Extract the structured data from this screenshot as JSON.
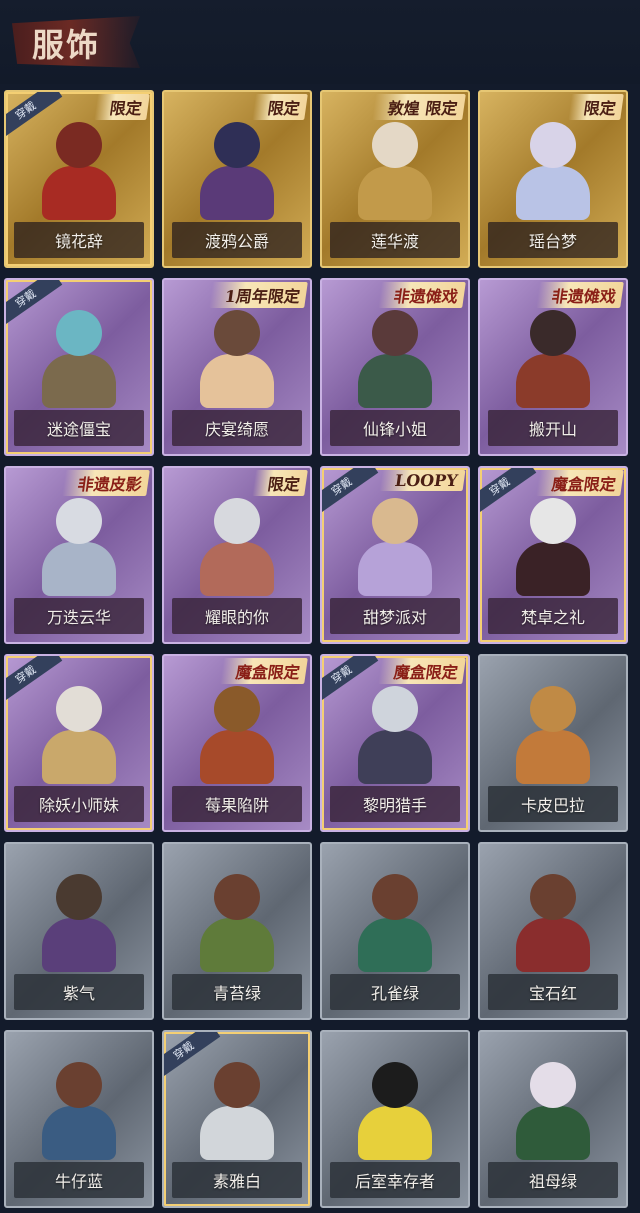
{
  "header": {
    "title": "服饰"
  },
  "cards": [
    {
      "name": "镜花辞",
      "tag": "限定",
      "equipped": true,
      "theme": "gold",
      "headColor": "#7a2a22",
      "bodyColor": "#a82b23"
    },
    {
      "name": "渡鸦公爵",
      "tag": "限定",
      "equipped": false,
      "theme": "gold",
      "headColor": "#2f2f56",
      "bodyColor": "#5a3a78"
    },
    {
      "name": "莲华渡",
      "tag": "敦煌\n限定",
      "equipped": false,
      "theme": "gold",
      "headColor": "#e4d8c6",
      "bodyColor": "#c29a4a"
    },
    {
      "name": "瑶台梦",
      "tag": "限定",
      "equipped": false,
      "theme": "gold",
      "headColor": "#d8d3e8",
      "bodyColor": "#b9c3e6"
    },
    {
      "name": "迷途僵宝",
      "tag": "",
      "equipped": true,
      "theme": "purple",
      "headColor": "#6bb6c3",
      "bodyColor": "#7b6a4d"
    },
    {
      "name": "庆宴绮愿",
      "tag": "1周年限定",
      "equipped": false,
      "theme": "purple",
      "headColor": "#6a4a3a",
      "bodyColor": "#e5c29a"
    },
    {
      "name": "仙锋小姐",
      "tag": "非遗傩戏",
      "equipped": false,
      "theme": "purple",
      "headColor": "#5a3a3a",
      "bodyColor": "#3b5a49"
    },
    {
      "name": "搬开山",
      "tag": "非遗傩戏",
      "equipped": false,
      "theme": "purple",
      "headColor": "#3a2a2a",
      "bodyColor": "#8b3b2a"
    },
    {
      "name": "万迭云华",
      "tag": "非遗皮影",
      "equipped": false,
      "theme": "purple",
      "headColor": "#d8dbe2",
      "bodyColor": "#a8b4c8"
    },
    {
      "name": "耀眼的你",
      "tag": "限定",
      "equipped": false,
      "theme": "purple",
      "headColor": "#d7d9de",
      "bodyColor": "#b26a5a"
    },
    {
      "name": "甜梦派对",
      "tag": "LOOPY",
      "equipped": true,
      "theme": "purple",
      "headColor": "#d9b98f",
      "bodyColor": "#b6a2d8"
    },
    {
      "name": "梵卓之礼",
      "tag": "魔盒限定",
      "equipped": true,
      "theme": "purple",
      "headColor": "#e6e6e6",
      "bodyColor": "#3a2226"
    },
    {
      "name": "除妖小师妹",
      "tag": "",
      "equipped": true,
      "theme": "purple",
      "headColor": "#e2ddd6",
      "bodyColor": "#c9a86b"
    },
    {
      "name": "莓果陷阱",
      "tag": "魔盒限定",
      "equipped": false,
      "theme": "purple",
      "headColor": "#8a5a2a",
      "bodyColor": "#a74a2a"
    },
    {
      "name": "黎明猎手",
      "tag": "魔盒限定",
      "equipped": true,
      "theme": "purple",
      "headColor": "#cfd4dc",
      "bodyColor": "#3f3f58"
    },
    {
      "name": "卡皮巴拉",
      "tag": "",
      "equipped": false,
      "theme": "gray",
      "headColor": "#c08a45",
      "bodyColor": "#c27a3a"
    },
    {
      "name": "紫气",
      "tag": "",
      "equipped": false,
      "theme": "gray",
      "headColor": "#4a3a30",
      "bodyColor": "#5a3f7a"
    },
    {
      "name": "青苔绿",
      "tag": "",
      "equipped": false,
      "theme": "gray",
      "headColor": "#6a4030",
      "bodyColor": "#5f7b3a"
    },
    {
      "name": "孔雀绿",
      "tag": "",
      "equipped": false,
      "theme": "gray",
      "headColor": "#6a4030",
      "bodyColor": "#2f6e57"
    },
    {
      "name": "宝石红",
      "tag": "",
      "equipped": false,
      "theme": "gray",
      "headColor": "#6a4030",
      "bodyColor": "#8a2d2d"
    },
    {
      "name": "牛仔蓝",
      "tag": "",
      "equipped": false,
      "theme": "gray",
      "headColor": "#6a4030",
      "bodyColor": "#3a5c82"
    },
    {
      "name": "素雅白",
      "tag": "",
      "equipped": true,
      "theme": "gray",
      "headColor": "#6a4030",
      "bodyColor": "#d2d6da"
    },
    {
      "name": "后室幸存者",
      "tag": "",
      "equipped": false,
      "theme": "gray",
      "headColor": "#1c1c1c",
      "bodyColor": "#e7d03b"
    },
    {
      "name": "祖母绿",
      "tag": "",
      "equipped": false,
      "theme": "gray",
      "headColor": "#e4dde8",
      "bodyColor": "#2f5b3a"
    }
  ],
  "labels": {
    "equipped": "穿戴"
  }
}
